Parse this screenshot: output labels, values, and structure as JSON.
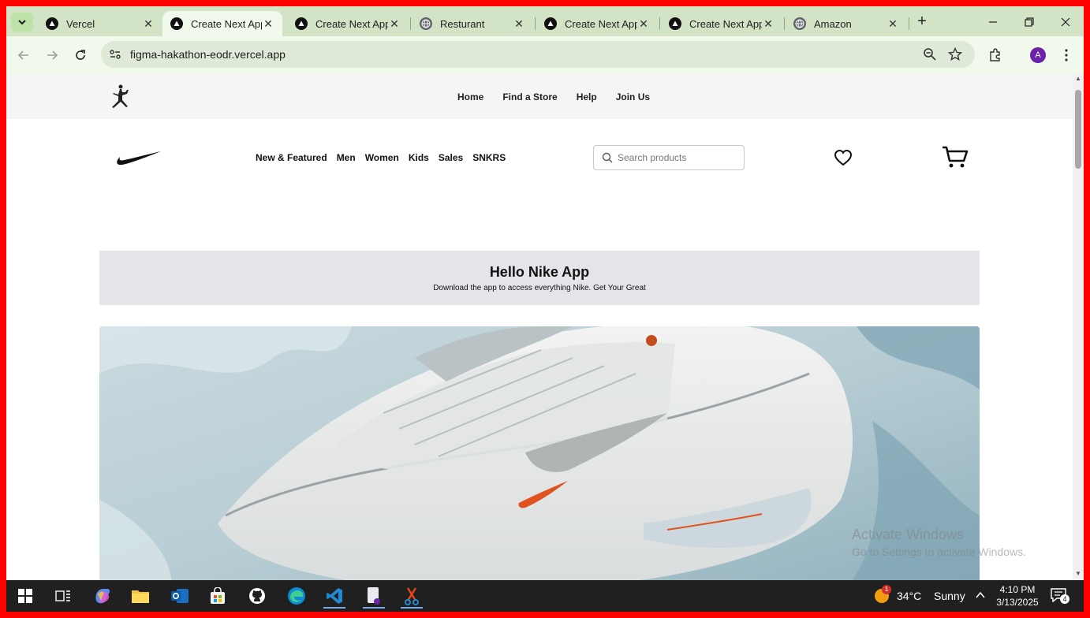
{
  "browser": {
    "tabs": [
      {
        "label": "Vercel",
        "icon": "vercel-icon"
      },
      {
        "label": "Create Next App",
        "icon": "vercel-icon",
        "active": true
      },
      {
        "label": "Create Next App",
        "icon": "vercel-icon"
      },
      {
        "label": "Resturant",
        "icon": "globe-icon"
      },
      {
        "label": "Create Next App",
        "icon": "vercel-icon"
      },
      {
        "label": "Create Next App",
        "icon": "vercel-icon"
      },
      {
        "label": "Amazon",
        "icon": "globe-icon"
      }
    ],
    "url": "figma-hakathon-eodr.vercel.app",
    "profile_initial": "A"
  },
  "page": {
    "topnav": [
      "Home",
      "Find a Store",
      "Help",
      "Join Us"
    ],
    "menu": [
      "New & Featured",
      "Men",
      "Women",
      "Kids",
      "Sales",
      "SNKRS"
    ],
    "search_placeholder": "Search products",
    "banner": {
      "title": "Hello Nike App",
      "subtitle": "Download the app to access everything Nike. Get Your Great"
    }
  },
  "watermark": {
    "line1": "Activate Windows",
    "line2": "Go to Settings to activate Windows."
  },
  "taskbar": {
    "weather_temp": "34°C",
    "weather_text": "Sunny",
    "weather_badge": "1",
    "time": "4:10 PM",
    "date": "3/13/2025",
    "notification_count": "4"
  },
  "colors": {
    "frame": "#ff0000",
    "tabstrip": "#d3e3c6",
    "toolbar": "#f1f8ec",
    "banner": "#e4e5e9",
    "taskbar": "#202020"
  }
}
